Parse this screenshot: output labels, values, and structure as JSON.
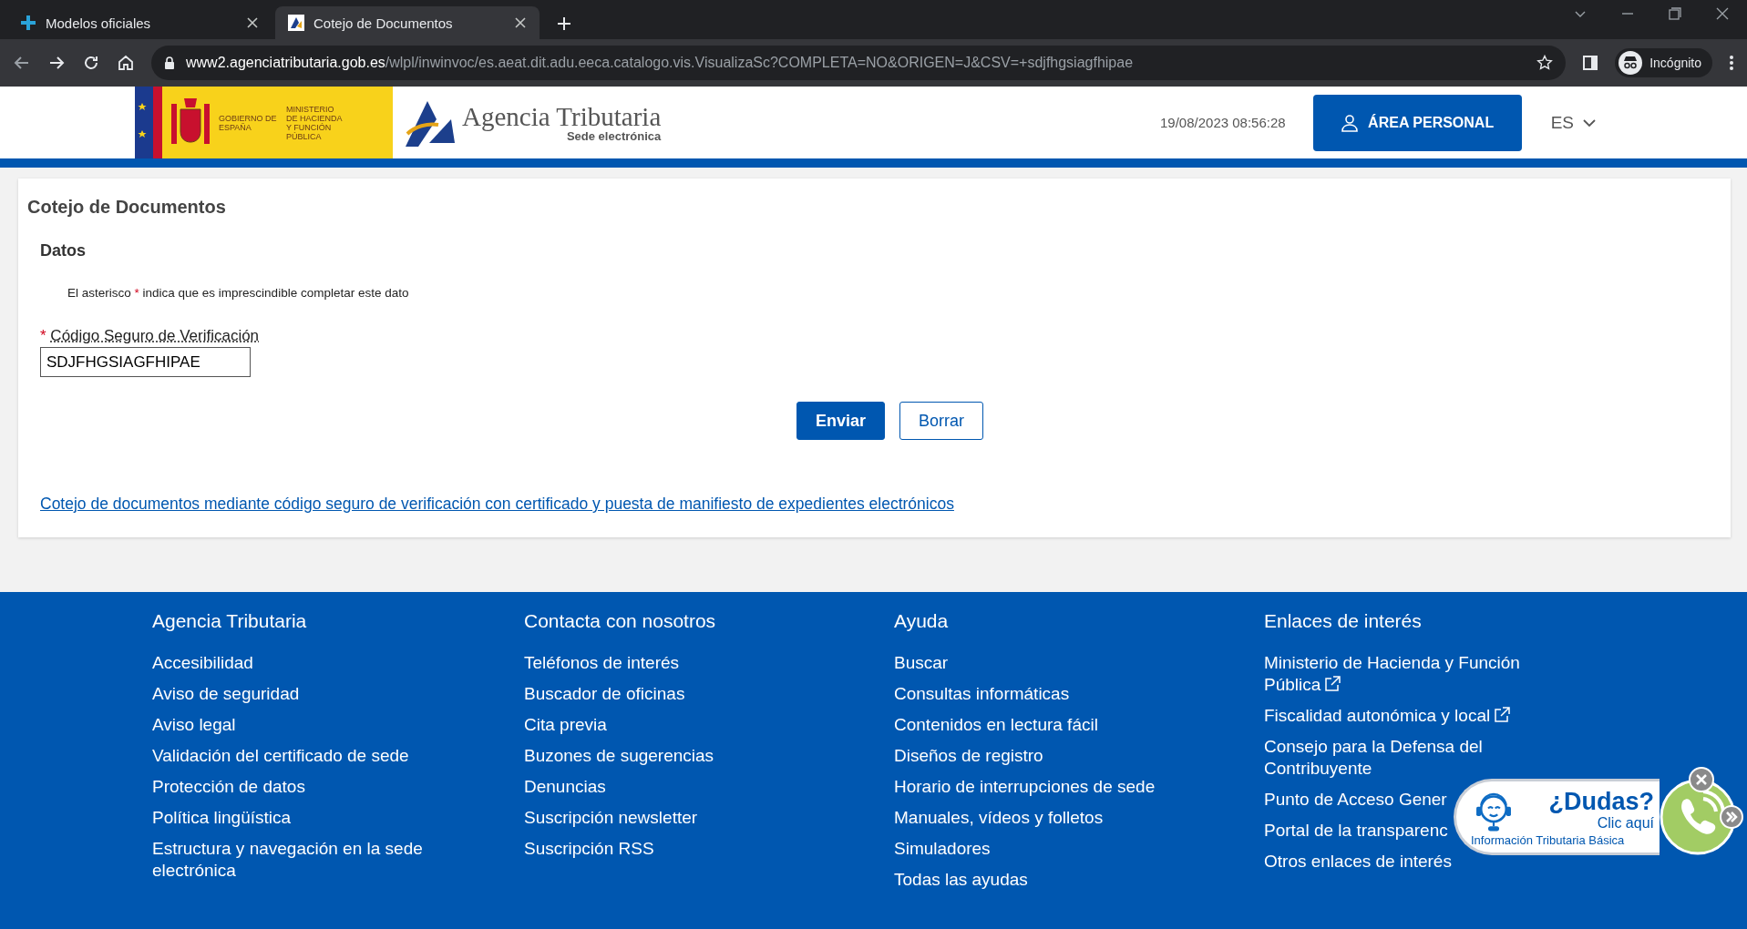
{
  "browser": {
    "tabs": [
      {
        "title": "Modelos oficiales",
        "selected": false
      },
      {
        "title": "Cotejo de Documentos",
        "selected": true
      }
    ],
    "url_host": "www2.agenciatributaria.gob.es",
    "url_path": "/wlpl/inwinvoc/es.aeat.dit.adu.eeca.catalogo.vis.VisualizaSc?COMPLETA=NO&ORIGEN=J&CSV=+sdjfhgsiagfhipae",
    "profile": "Incógnito"
  },
  "header": {
    "gov_logo": "GOBIERNO DE ESPAÑA",
    "ministry": "MINISTERIO DE HACIENDA Y FUNCIÓN PÚBLICA",
    "agency": "Agencia Tributaria",
    "agency_sub": "Sede electrónica",
    "datetime": "19/08/2023 08:56:28",
    "personal_button": "ÁREA PERSONAL",
    "language": "ES"
  },
  "form": {
    "title": "Cotejo de Documentos",
    "section": "Datos",
    "note_start": "El asterisco",
    "note_mark": "*",
    "note_end": "indica que es imprescindible completar este dato",
    "field": {
      "required_mark": "*",
      "label": "Código Seguro de Verificación",
      "value": "SDJFHGSIAGFHIPAE"
    },
    "buttons": [
      {
        "label": "Enviar",
        "kind": "primary"
      },
      {
        "label": "Borrar",
        "kind": "secondary"
      }
    ],
    "link": "Cotejo de documentos mediante código seguro de verificación con certificado y puesta de manifiesto de expedientes electrónicos"
  },
  "footer": {
    "columns": [
      {
        "title": "Agencia Tributaria",
        "links": [
          {
            "label": "Accesibilidad",
            "external": false
          },
          {
            "label": "Aviso de seguridad",
            "external": false
          },
          {
            "label": "Aviso legal",
            "external": false
          },
          {
            "label": "Validación del certificado de sede",
            "external": false
          },
          {
            "label": "Protección de datos",
            "external": false
          },
          {
            "label": "Política lingüística",
            "external": false
          },
          {
            "label": "Estructura y navegación en la sede electrónica",
            "external": false
          }
        ]
      },
      {
        "title": "Contacta con nosotros",
        "links": [
          {
            "label": "Teléfonos de interés",
            "external": false
          },
          {
            "label": "Buscador de oficinas",
            "external": false
          },
          {
            "label": "Cita previa",
            "external": false
          },
          {
            "label": "Buzones de sugerencias",
            "external": false
          },
          {
            "label": "Denuncias",
            "external": false
          },
          {
            "label": "Suscripción newsletter",
            "external": false
          },
          {
            "label": "Suscripción RSS",
            "external": false
          }
        ]
      },
      {
        "title": "Ayuda",
        "links": [
          {
            "label": "Buscar",
            "external": false
          },
          {
            "label": "Consultas informáticas",
            "external": false
          },
          {
            "label": "Contenidos en lectura fácil",
            "external": false
          },
          {
            "label": "Diseños de registro",
            "external": false
          },
          {
            "label": "Horario de interrupciones de sede",
            "external": false
          },
          {
            "label": "Manuales, vídeos y folletos",
            "external": false
          },
          {
            "label": "Simuladores",
            "external": false
          },
          {
            "label": "Todas las ayudas",
            "external": false
          }
        ]
      },
      {
        "title": "Enlaces de interés",
        "links": [
          {
            "label": "Ministerio de Hacienda y Función Pública",
            "external": true
          },
          {
            "label": "Fiscalidad autonómica y local",
            "external": true
          },
          {
            "label": "Consejo para la Defensa del Contribuyente",
            "external": false
          },
          {
            "label": "Punto de Acceso Gener",
            "external": false
          },
          {
            "label": "Portal de la transparenc",
            "external": false
          },
          {
            "label": "Otros enlaces de interés",
            "external": false
          }
        ]
      }
    ]
  },
  "help_widget": {
    "title": "¿Dudas?",
    "action": "Clic aquí",
    "subtitle": "Información Tributaria Básica"
  }
}
